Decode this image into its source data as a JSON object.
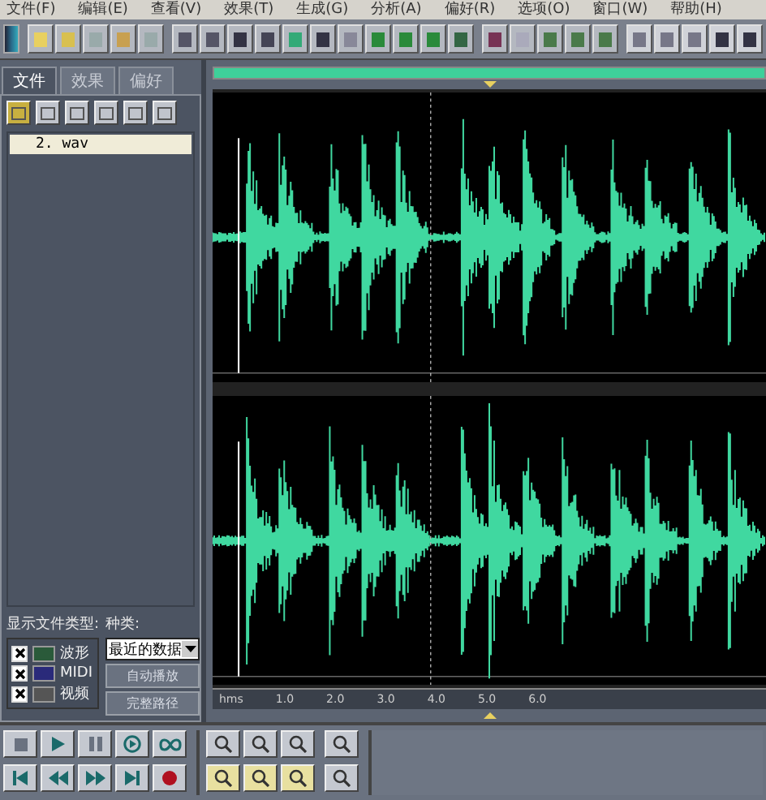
{
  "menu": [
    {
      "label": "文件(F)"
    },
    {
      "label": "编辑(E)"
    },
    {
      "label": "查看(V)"
    },
    {
      "label": "效果(T)"
    },
    {
      "label": "生成(G)"
    },
    {
      "label": "分析(A)"
    },
    {
      "label": "偏好(R)"
    },
    {
      "label": "选项(O)"
    },
    {
      "label": "窗口(W)"
    },
    {
      "label": "帮助(H)"
    }
  ],
  "panel": {
    "tabs": [
      {
        "label": "文件",
        "selected": true
      },
      {
        "label": "效果",
        "selected": false
      },
      {
        "label": "偏好",
        "selected": false
      }
    ],
    "files": [
      {
        "name": "2. wav",
        "selected": true
      }
    ],
    "filter_label": "显示文件类型:",
    "file_types": [
      {
        "label": "波形",
        "checked": true,
        "kind": "wave"
      },
      {
        "label": "MIDI",
        "checked": true,
        "kind": "midi"
      },
      {
        "label": "视频",
        "checked": true,
        "kind": "video"
      }
    ],
    "sort_label": "种类:",
    "sort_value": "最近的数据",
    "buttons": [
      "自动播放",
      "完整路径"
    ]
  },
  "ruler": {
    "unit": "hms",
    "ticks": [
      "1.0",
      "2.0",
      "3.0",
      "4.0",
      "5.0",
      "6.0"
    ]
  }
}
